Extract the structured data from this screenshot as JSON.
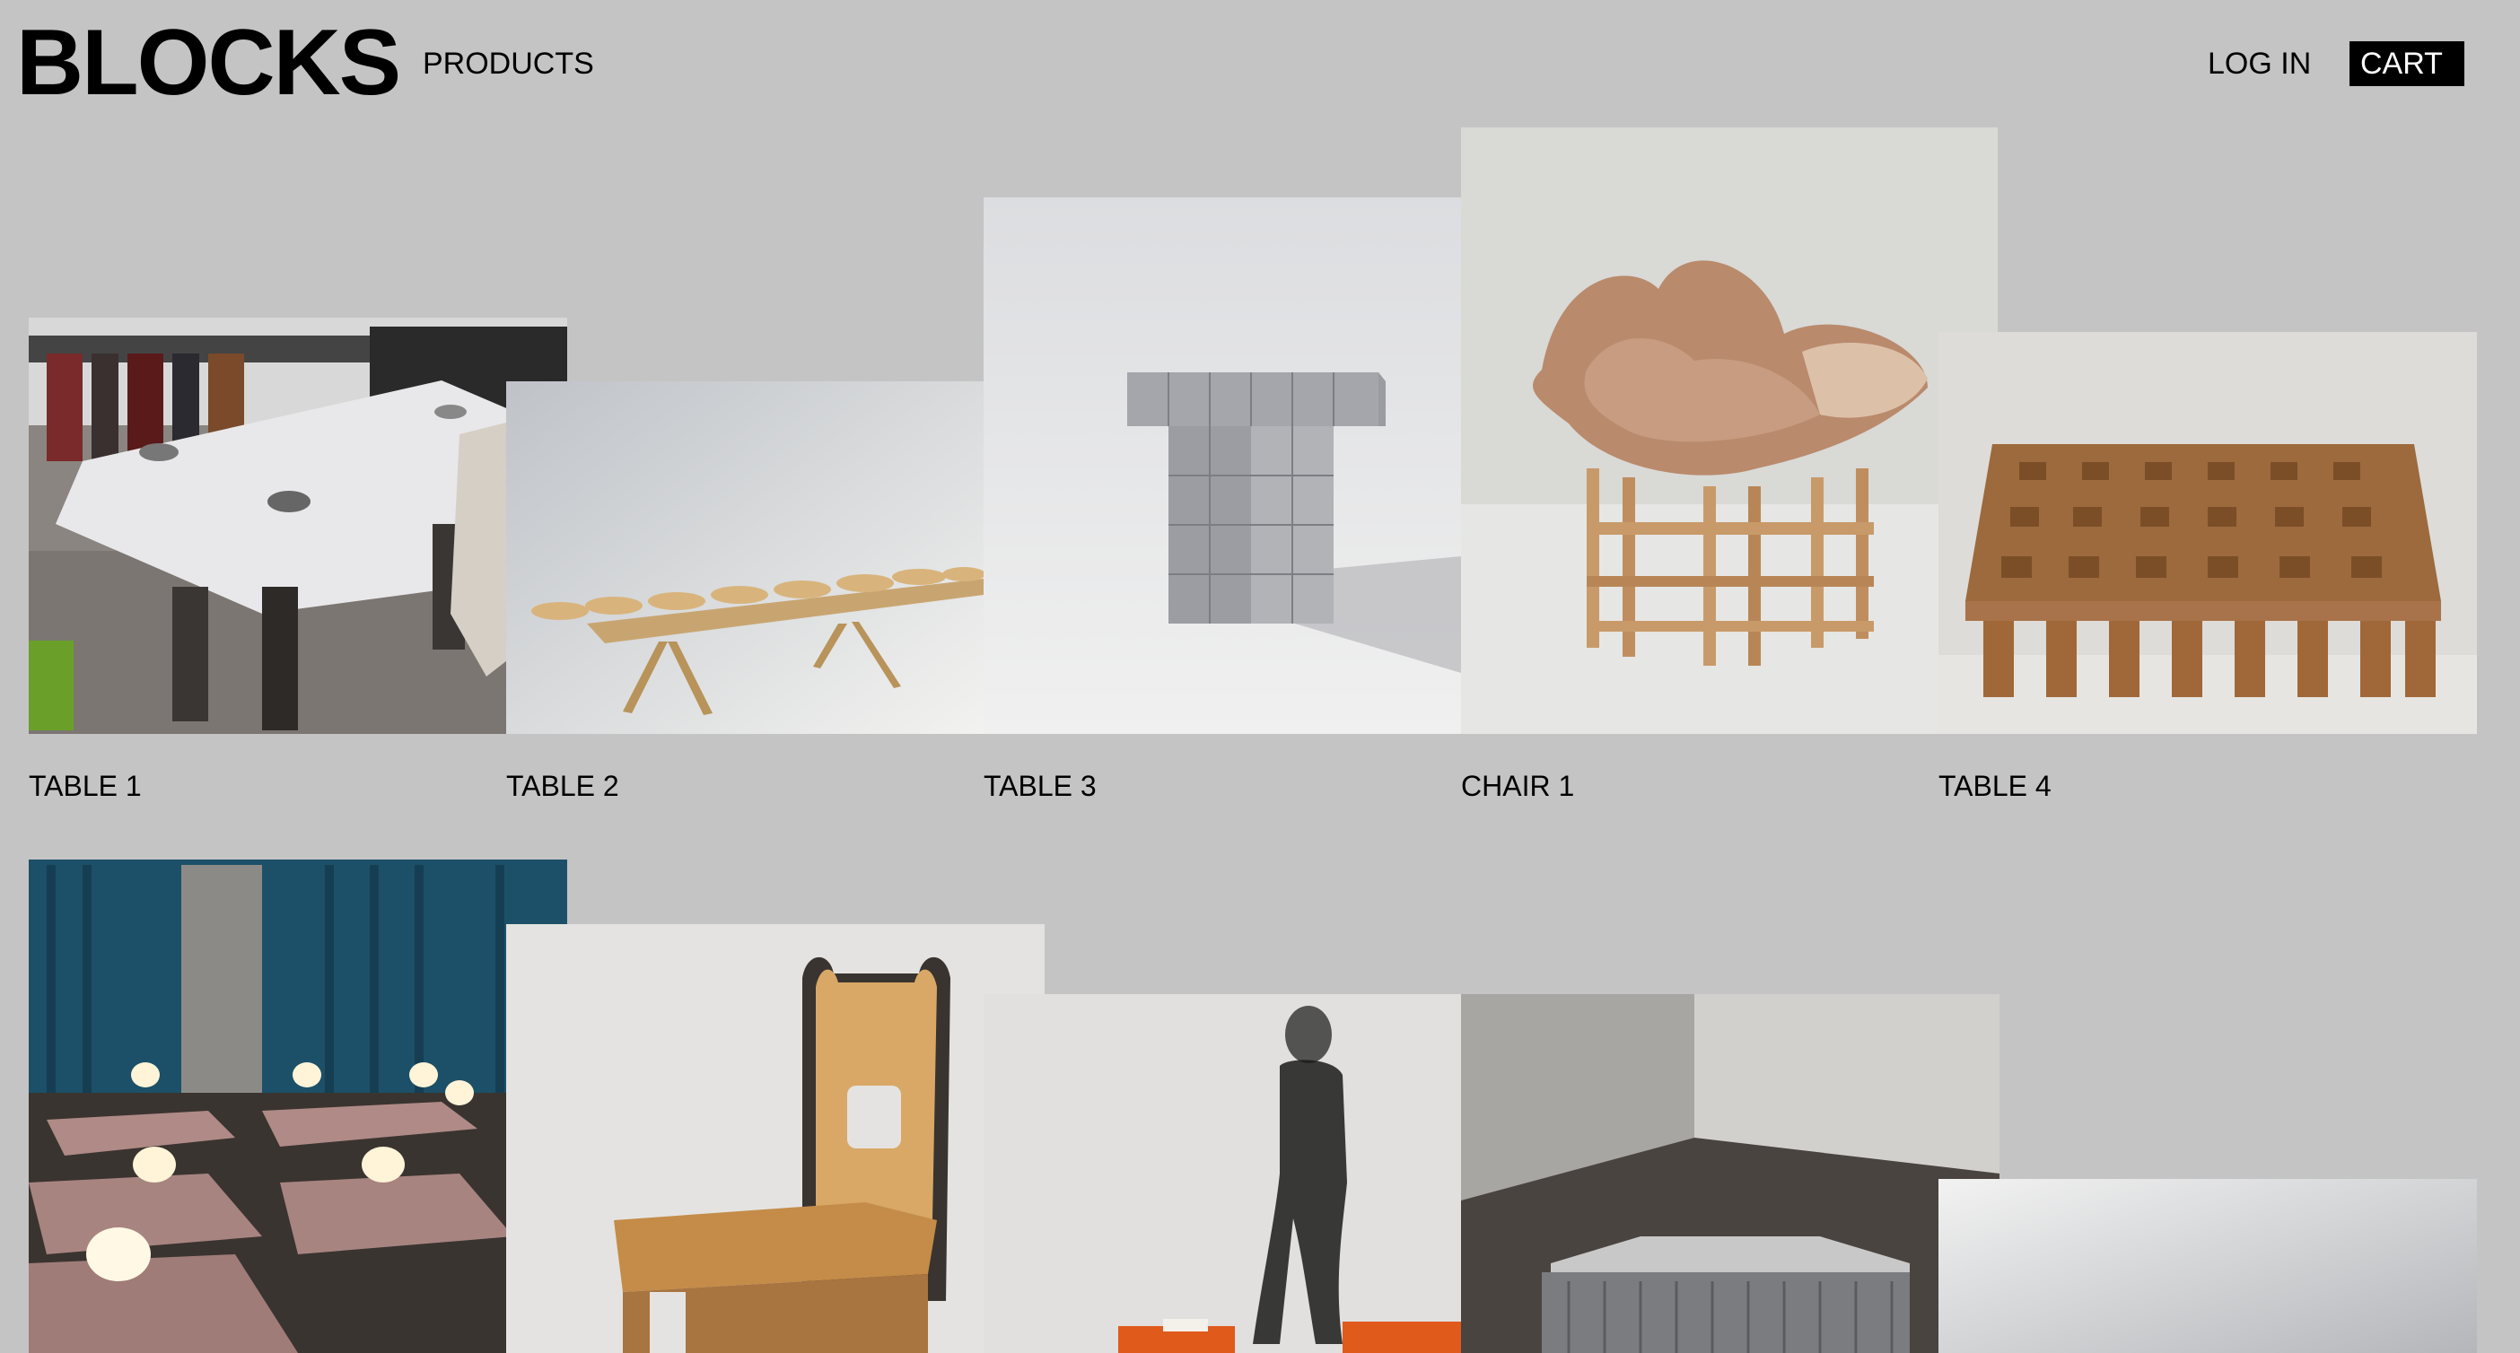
{
  "header": {
    "logo": "BLOCKS",
    "nav_products": "PRODUCTS",
    "nav_login": "LOG IN",
    "nav_cart": "CART"
  },
  "products": [
    {
      "label": "TABLE 1",
      "image": "frosted-glass-table-photo"
    },
    {
      "label": "TABLE 2",
      "image": "wooden-disc-bench-photo"
    },
    {
      "label": "TABLE 3",
      "image": "aluminum-block-stool-photo"
    },
    {
      "label": "CHAIR 1",
      "image": "leather-lattice-chair-photo"
    },
    {
      "label": "TABLE 4",
      "image": "parquet-coffee-table-photo"
    }
  ],
  "row2_images": [
    "tiled-tables-with-lamps-photo",
    "wooden-bunny-chair-photo",
    "person-walking-orange-blocks-photo",
    "metal-table-in-room-photo",
    "grey-gradient-photo"
  ],
  "colors": {
    "background": "#c4c4c4",
    "cart_bg": "#000000",
    "cart_text": "#ffffff"
  }
}
